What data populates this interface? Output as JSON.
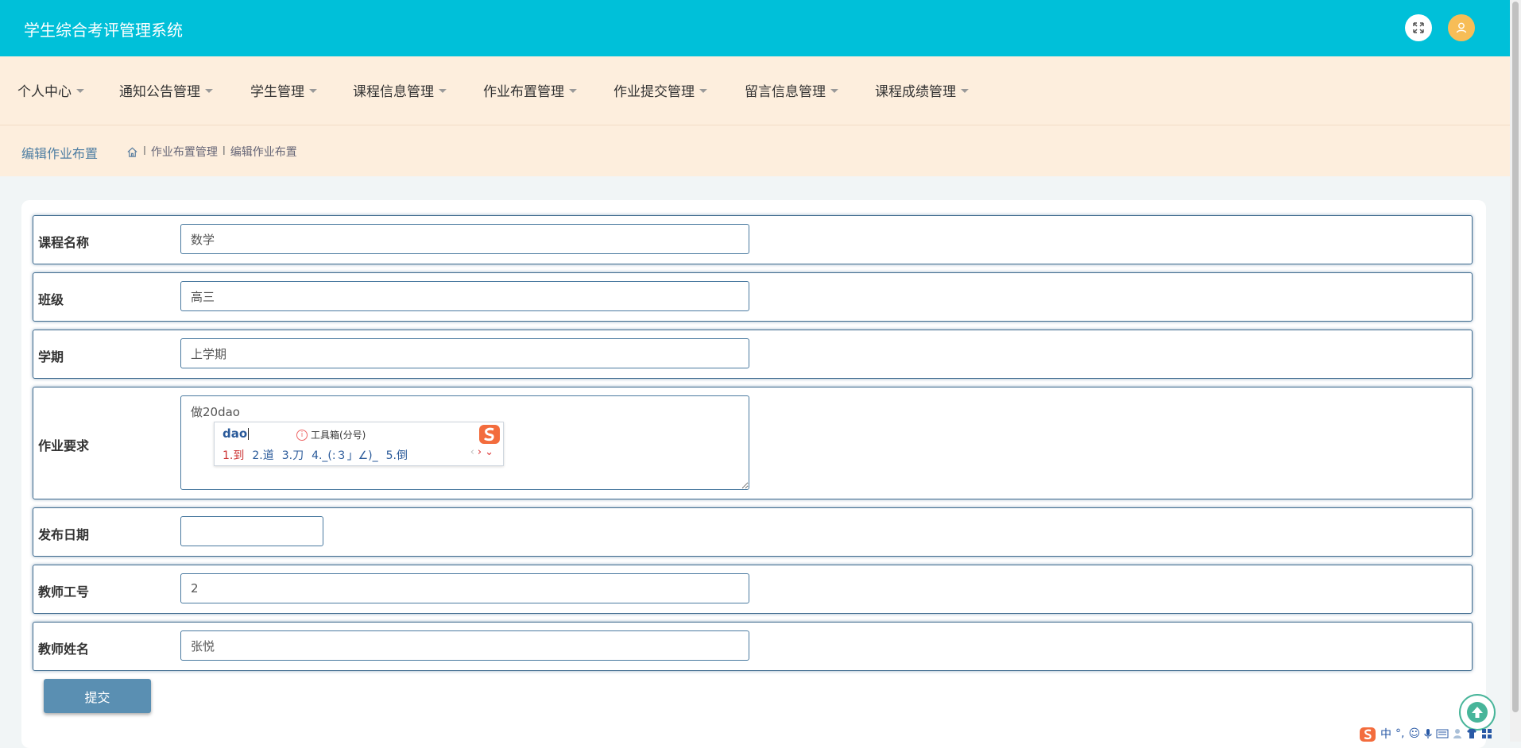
{
  "header": {
    "app_title": "学生综合考评管理系统",
    "fullscreen_icon": "fullscreen-icon",
    "avatar_icon": "user-avatar-icon"
  },
  "menu": {
    "items": [
      {
        "label": "个人中心"
      },
      {
        "label": "通知公告管理"
      },
      {
        "label": "学生管理"
      },
      {
        "label": "课程信息管理"
      },
      {
        "label": "作业布置管理"
      },
      {
        "label": "作业提交管理"
      },
      {
        "label": "留言信息管理"
      },
      {
        "label": "课程成绩管理"
      }
    ]
  },
  "breadcrumb": {
    "page_title": "编辑作业布置",
    "sep": "l",
    "level1": "作业布置管理",
    "level2": "编辑作业布置"
  },
  "form": {
    "course_name": {
      "label": "课程名称",
      "value": "数学"
    },
    "class": {
      "label": "班级",
      "value": "高三"
    },
    "semester": {
      "label": "学期",
      "value": "上学期"
    },
    "requirement": {
      "label": "作业要求",
      "value": "做20dao"
    },
    "publish_date": {
      "label": "发布日期",
      "value": ""
    },
    "teacher_id": {
      "label": "教师工号",
      "value": "2"
    },
    "teacher_name": {
      "label": "教师姓名",
      "value": "张悦"
    },
    "submit_label": "提交"
  },
  "ime_popup": {
    "input": "dao",
    "toolbox": "工具箱(分号)",
    "candidates": [
      "1.到",
      "2.道",
      "3.刀",
      "4._(:３」∠)_",
      "5.倒"
    ]
  },
  "ime_status": {
    "mode": "中",
    "punct": "°,"
  },
  "colors": {
    "topbar": "#00c0d9",
    "menubar": "#fdeedd",
    "accent": "#5a8fb2",
    "avatar": "#f7bd57"
  }
}
